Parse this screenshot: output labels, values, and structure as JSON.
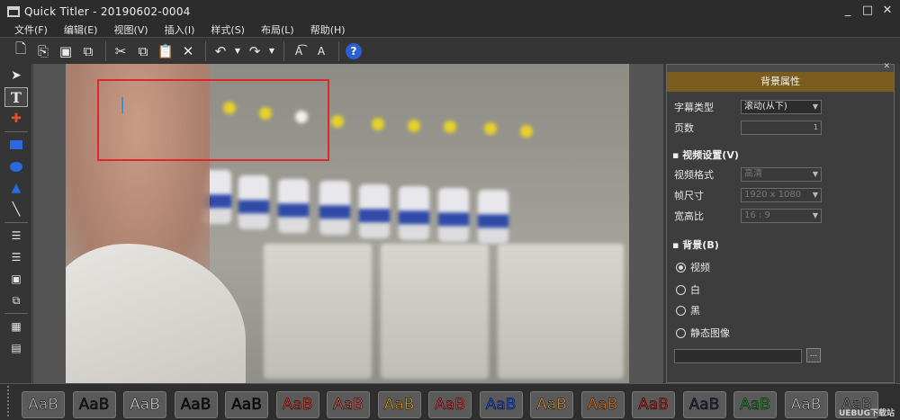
{
  "window": {
    "title": "Quick Titler - 20190602-0004"
  },
  "menu": [
    "文件(F)",
    "编辑(E)",
    "视图(V)",
    "插入(I)",
    "样式(S)",
    "布局(L)",
    "帮助(H)"
  ],
  "toolbar": {
    "help_label": "?"
  },
  "panel": {
    "title": "背景属性",
    "subtitle_type_label": "字幕类型",
    "subtitle_type_value": "滚动(从下)",
    "pages_label": "页数",
    "pages_value": "1",
    "video_section": "视频设置(V)",
    "video_format_label": "视频格式",
    "video_format_value": "高清",
    "frame_size_label": "帧尺寸",
    "frame_size_value": "1920 x 1080",
    "aspect_label": "宽高比",
    "aspect_value": "16 : 9",
    "bg_section": "背景(B)",
    "bg_options": [
      "视频",
      "白",
      "黑",
      "静态图像"
    ],
    "bg_selected": "视频",
    "browse_label": "..."
  },
  "styles": {
    "sample_text": "AaB",
    "colors": [
      "#c8c8c8",
      "#1e1e1e",
      "#e4e4e4",
      "#151515",
      "#111111",
      "#e83a2a",
      "#e65a4a",
      "#e8a21a",
      "#f23a3a",
      "#2255ee",
      "#d8a040",
      "#f07a1a",
      "#c8281c",
      "#2a2a4a",
      "#1a9a2a",
      "#d0d0d0",
      "#888888"
    ]
  },
  "watermark": "UEBUG下载站"
}
